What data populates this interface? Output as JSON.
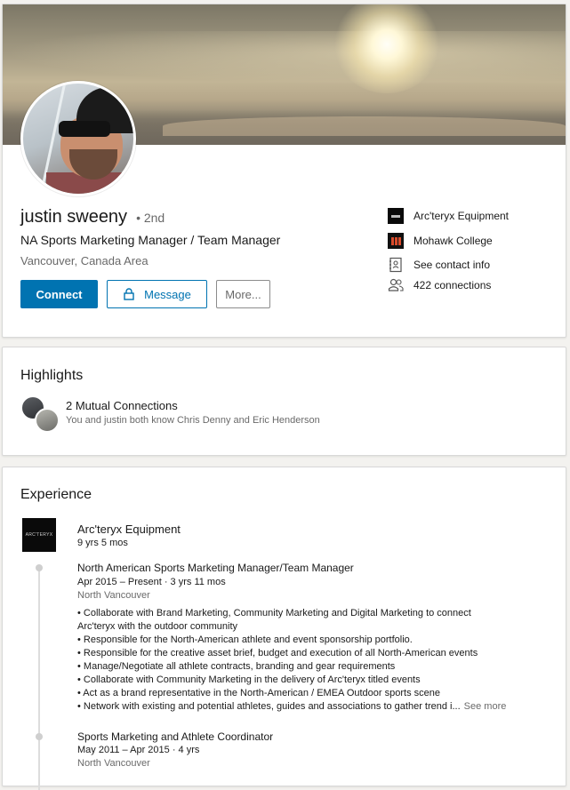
{
  "profile": {
    "name": "justin sweeny",
    "degree": "• 2nd",
    "headline": "NA Sports Marketing Manager / Team Manager",
    "location": "Vancouver, Canada Area"
  },
  "actions": {
    "connect": "Connect",
    "message": "Message",
    "more": "More..."
  },
  "sidebar": {
    "items": [
      {
        "icon": "arcteryx-logo",
        "label": "Arc'teryx Equipment"
      },
      {
        "icon": "mohawk-college-logo",
        "label": "Mohawk College"
      },
      {
        "icon": "contact-card-icon",
        "label": "See contact info"
      },
      {
        "icon": "people-icon",
        "label": "422 connections"
      }
    ]
  },
  "highlights": {
    "title": "Highlights",
    "mutual_title": "2 Mutual Connections",
    "mutual_subtitle": "You and justin both know Chris Denny and Eric Henderson"
  },
  "experience": {
    "title": "Experience",
    "company": "Arc'teryx Equipment",
    "logo_text": "ARC'TERYX",
    "tenure": "9 yrs 5 mos",
    "roles": [
      {
        "title": "North American Sports Marketing Manager/Team Manager",
        "dates": "Apr 2015 – Present · 3 yrs 11 mos",
        "location": "North Vancouver",
        "description": [
          "• Collaborate with Brand Marketing, Community Marketing and Digital Marketing to connect",
          "Arc'teryx with the outdoor community",
          "• Responsible for the North-American athlete and event sponsorship portfolio.",
          "• Responsible for the creative asset brief, budget and execution of all North-American events",
          "• Manage/Negotiate all athlete contracts, branding and gear requirements",
          "• Collaborate with Community Marketing in the delivery of Arc'teryx titled events",
          "• Act as a brand representative in the North-American / EMEA Outdoor sports scene",
          "• Network with existing and potential athletes, guides and associations to gather trend i..."
        ],
        "see_more": "See more"
      },
      {
        "title": "Sports Marketing and Athlete Coordinator",
        "dates": "May 2011 – Apr 2015 · 4 yrs",
        "location": "North Vancouver"
      }
    ]
  },
  "colors": {
    "primary": "#0073b1",
    "background": "#f3f2ef",
    "card": "#ffffff"
  }
}
